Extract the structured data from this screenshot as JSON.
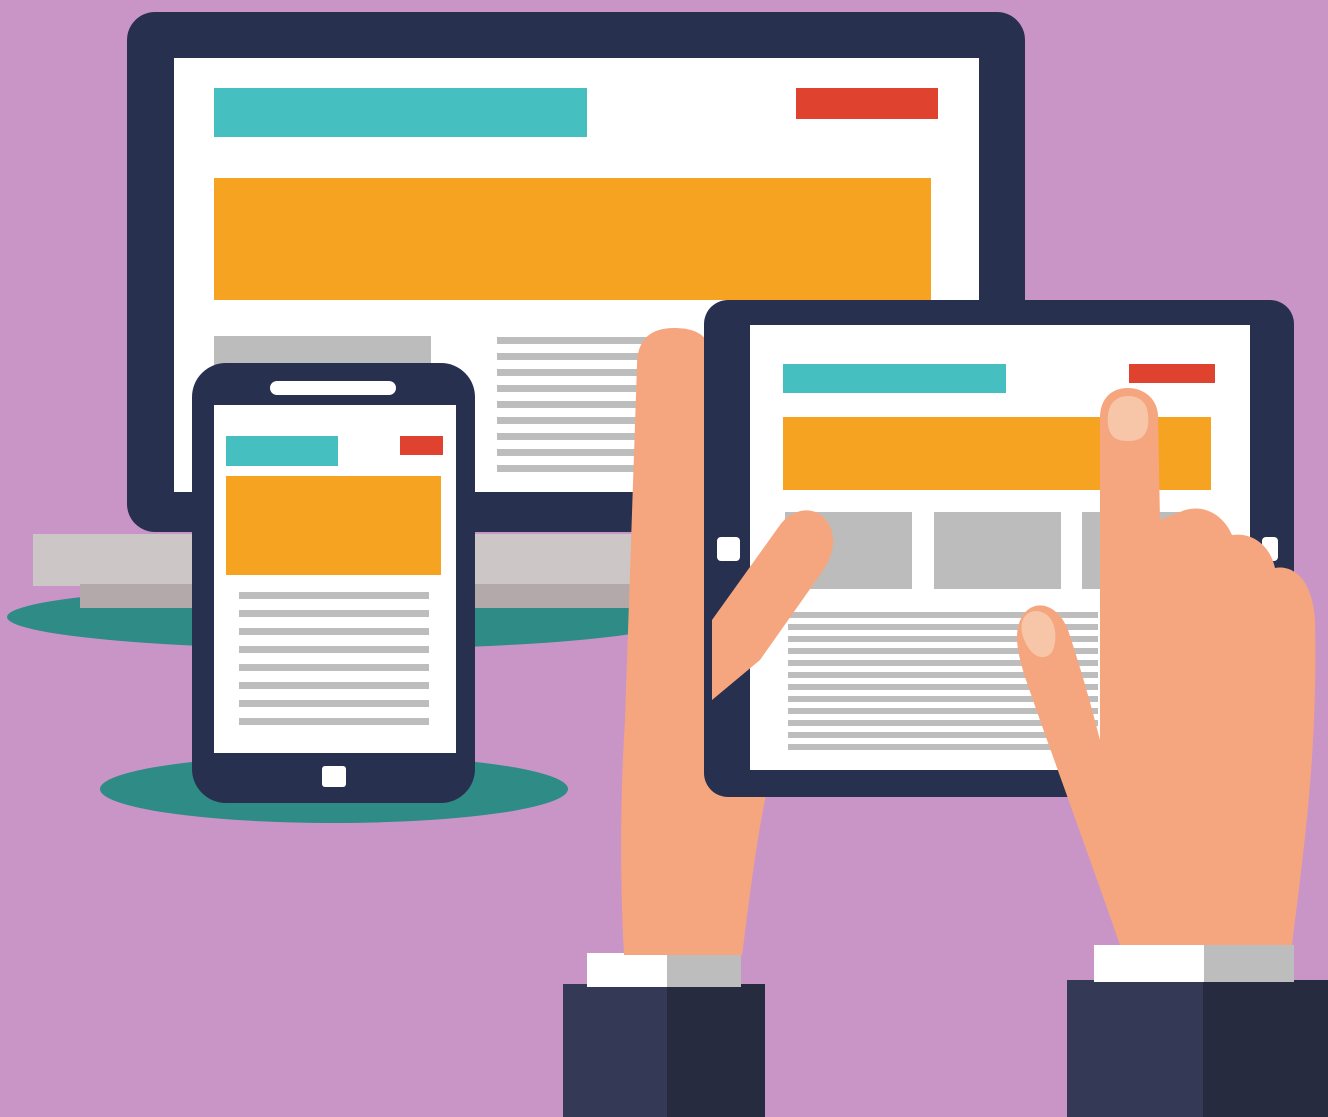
{
  "illustration": {
    "theme": "responsive-web-design",
    "devices": [
      "desktop-monitor",
      "smartphone",
      "tablet"
    ],
    "icons": [
      "monitor-icon",
      "phone-icon",
      "tablet-icon",
      "hand-icon"
    ]
  },
  "colors": {
    "background": "#c995c7",
    "device_frame": "#28304f",
    "screen": "#ffffff",
    "header_bar": "#45bfbf",
    "accent_button": "#df4330",
    "banner": "#f5a321",
    "placeholder_block": "#bcbcbc",
    "text_line": "#bdbdbd",
    "stand_top": "#cdc6c7",
    "stand_shadow": "#b3a9aa",
    "shadow_teal": "#2f8b86",
    "skin": "#f6a67f",
    "nail": "#f7c5a7",
    "cuff": "#ffffff",
    "cuff_shade": "#bdbdbd",
    "sleeve": "#343a56",
    "sleeve_shade": "#262b40"
  }
}
